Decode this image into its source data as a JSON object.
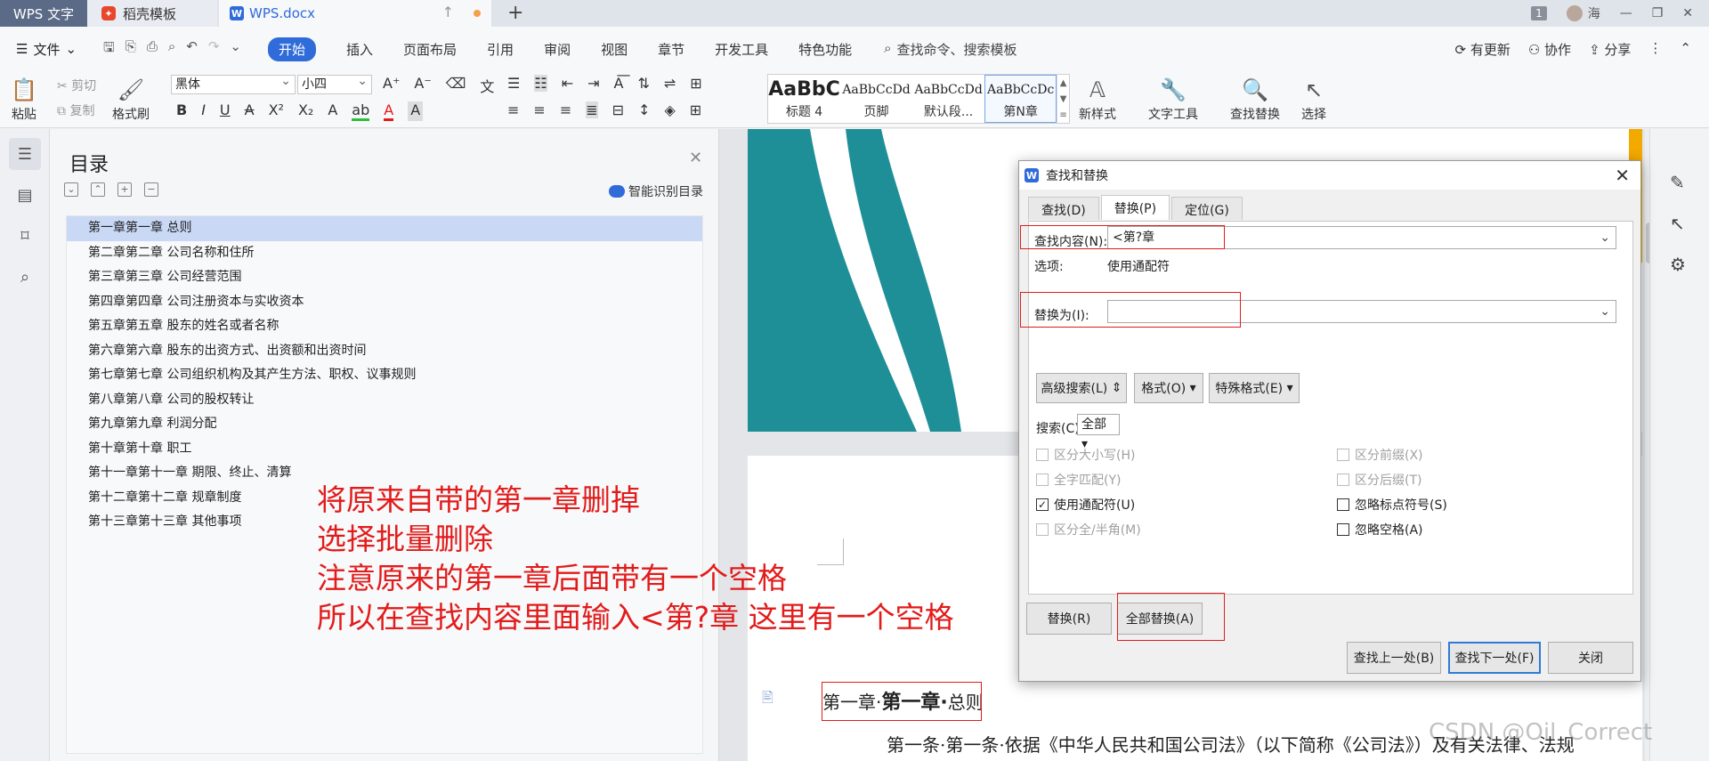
{
  "titlebar": {
    "tabs": [
      {
        "label": "WPS 文字"
      },
      {
        "label": "稻壳模板"
      },
      {
        "label": "WPS.docx"
      }
    ],
    "page_badge": "1",
    "user": "海"
  },
  "menubar": {
    "file": "文件",
    "items": [
      "开始",
      "插入",
      "页面布局",
      "引用",
      "审阅",
      "视图",
      "章节",
      "开发工具",
      "特色功能"
    ],
    "search": "查找命令、搜索模板",
    "right": [
      "有更新",
      "协作",
      "分享"
    ]
  },
  "ribbon": {
    "paste": "粘贴",
    "cut": "剪切",
    "copy": "复制",
    "format_painter": "格式刷",
    "font_name": "黑体",
    "font_size": "小四",
    "styles": [
      {
        "preview": "AaBbC",
        "name": "标题 4"
      },
      {
        "preview": "AaBbCcDd",
        "name": "页脚"
      },
      {
        "preview": "AaBbCcDd",
        "name": "默认段..."
      },
      {
        "preview": "AaBbCcDc",
        "name": "第N章"
      }
    ],
    "new_style": "新样式",
    "text_tools": "文字工具",
    "find_replace": "查找替换",
    "select": "选择"
  },
  "toc": {
    "title": "目录",
    "smart": "智能识别目录",
    "items": [
      "第一章第一章  总则",
      "第二章第二章  公司名称和住所",
      "第三章第三章  公司经营范围",
      "第四章第四章  公司注册资本与实收资本",
      "第五章第五章  股东的姓名或者名称",
      "第六章第六章  股东的出资方式、出资额和出资时间",
      "第七章第七章  公司组织机构及其产生方法、职权、议事规则",
      "第八章第八章  公司的股权转让",
      "第九章第九章  利润分配",
      "第十章第十章  职工",
      "第十一章第十一章  期限、终止、清算",
      "第十二章第十二章  规章制度",
      "第十三章第十三章  其他事项"
    ]
  },
  "annotation": {
    "lines": [
      "将原来自带的第一章删掉",
      "选择批量删除",
      "注意原来的第一章后面带有一个空格",
      "所以在查找内容里面输入<第?章 这里有一个空格"
    ]
  },
  "document": {
    "heading_prefix": "第一章·",
    "heading_bold": "第一章·",
    "heading_suffix": "总则",
    "line": "第一条·第一条·依据《中华人民共和国公司法》（以下简称《公司法》）及有关法律、法规"
  },
  "dialog": {
    "title": "查找和替换",
    "tabs": [
      "查找(D)",
      "替换(P)",
      "定位(G)"
    ],
    "find_label": "查找内容(N):",
    "find_value": "<第?章",
    "options_label": "选项:",
    "options_value": "使用通配符",
    "replace_label": "替换为(I):",
    "replace_value": "",
    "buttons_mid": [
      "高级搜索(L)",
      "格式(O)",
      "特殊格式(E)"
    ],
    "search_label": "搜索(C)",
    "search_value": "全部",
    "checks_left": [
      {
        "label": "区分大小写(H)",
        "checked": false,
        "disabled": true
      },
      {
        "label": "全字匹配(Y)",
        "checked": false,
        "disabled": true
      },
      {
        "label": "使用通配符(U)",
        "checked": true,
        "disabled": false
      },
      {
        "label": "区分全/半角(M)",
        "checked": false,
        "disabled": true
      }
    ],
    "checks_right": [
      {
        "label": "区分前缀(X)",
        "checked": false,
        "disabled": true
      },
      {
        "label": "区分后缀(T)",
        "checked": false,
        "disabled": true
      },
      {
        "label": "忽略标点符号(S)",
        "checked": false,
        "disabled": false
      },
      {
        "label": "忽略空格(A)",
        "checked": false,
        "disabled": false
      }
    ],
    "replace_btn": "替换(R)",
    "replace_all_btn": "全部替换(A)",
    "find_prev_btn": "查找上一处(B)",
    "find_next_btn": "查找下一处(F)",
    "close_btn": "关闭"
  },
  "watermark": "CSDN @Oil_Correct",
  "colors": {
    "accent": "#2f6bd9",
    "annotation": "#e21b1b",
    "teal": "#1f8f97"
  }
}
